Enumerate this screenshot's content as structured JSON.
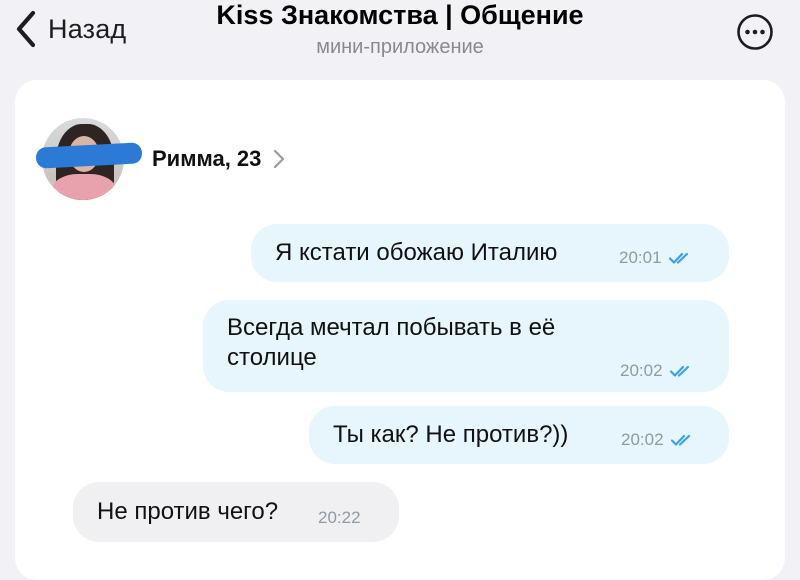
{
  "header": {
    "back_label": "Назад",
    "title": "Kiss Знакомства | Общение",
    "subtitle": "мини-приложение"
  },
  "profile": {
    "name": "Римма, 23"
  },
  "messages": [
    {
      "direction": "out",
      "text": "Я кстати обожаю Италию",
      "time": "20:01",
      "status": "read"
    },
    {
      "direction": "out",
      "text": "Всегда мечтал побывать в её столице",
      "time": "20:02",
      "status": "read"
    },
    {
      "direction": "out",
      "text": "Ты как? Не против?))",
      "time": "20:02",
      "status": "read"
    },
    {
      "direction": "in",
      "text": "Не против чего?",
      "time": "20:22"
    }
  ],
  "colors": {
    "outgoing_bubble": "#e7f5fd",
    "incoming_bubble": "#f0f0f2",
    "read_check": "#3aa3e3",
    "background": "#f2f2f6"
  },
  "icons": {
    "back": "chevron-left-icon",
    "more": "more-horizontal-circle-icon",
    "profile_chevron": "chevron-right-icon",
    "read_status": "double-check-icon"
  }
}
